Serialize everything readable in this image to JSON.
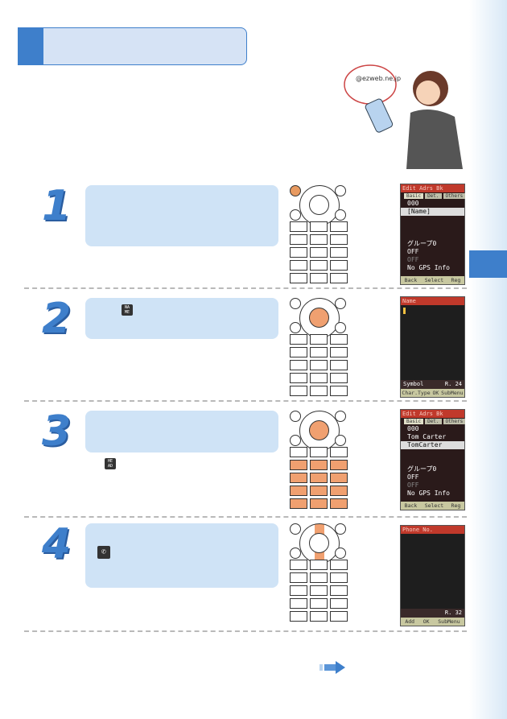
{
  "accent": "#3e7fcb",
  "screens": {
    "s1": {
      "title": "Edit Adrs Bk",
      "tabs": [
        "Basic",
        "Det.",
        "Others"
      ],
      "rows": [
        "000",
        "[Name]",
        "",
        "",
        "",
        "グループ0",
        "OFF",
        "OFF",
        "No GPS Info"
      ],
      "softkeys": [
        "Back",
        "Select",
        "Reg"
      ]
    },
    "s2": {
      "title": "Name",
      "status": "Symbol",
      "remaining": "R.  24",
      "softkeys": [
        "Char.Type",
        "OK",
        "SubMenu"
      ]
    },
    "s3": {
      "title": "Edit Adrs Bk",
      "tabs": [
        "Basic",
        "Det.",
        "Others"
      ],
      "rows": [
        "000",
        "Tom Carter",
        "TomCarter",
        "",
        "",
        "グループ0",
        "OFF",
        "OFF",
        "No GPS Info"
      ],
      "softkeys": [
        "Back",
        "Select",
        "Reg"
      ]
    },
    "s4": {
      "title": "Phone No.",
      "remaining": "R. 32",
      "softkeys": [
        "Add",
        "OK",
        "SubMenu"
      ]
    }
  },
  "steps": [
    "1",
    "2",
    "3",
    "4"
  ],
  "icons": {
    "name": "NA ME",
    "head": "HE AD"
  },
  "illustration": {
    "bubble": "@ezweb.ne.jp"
  }
}
